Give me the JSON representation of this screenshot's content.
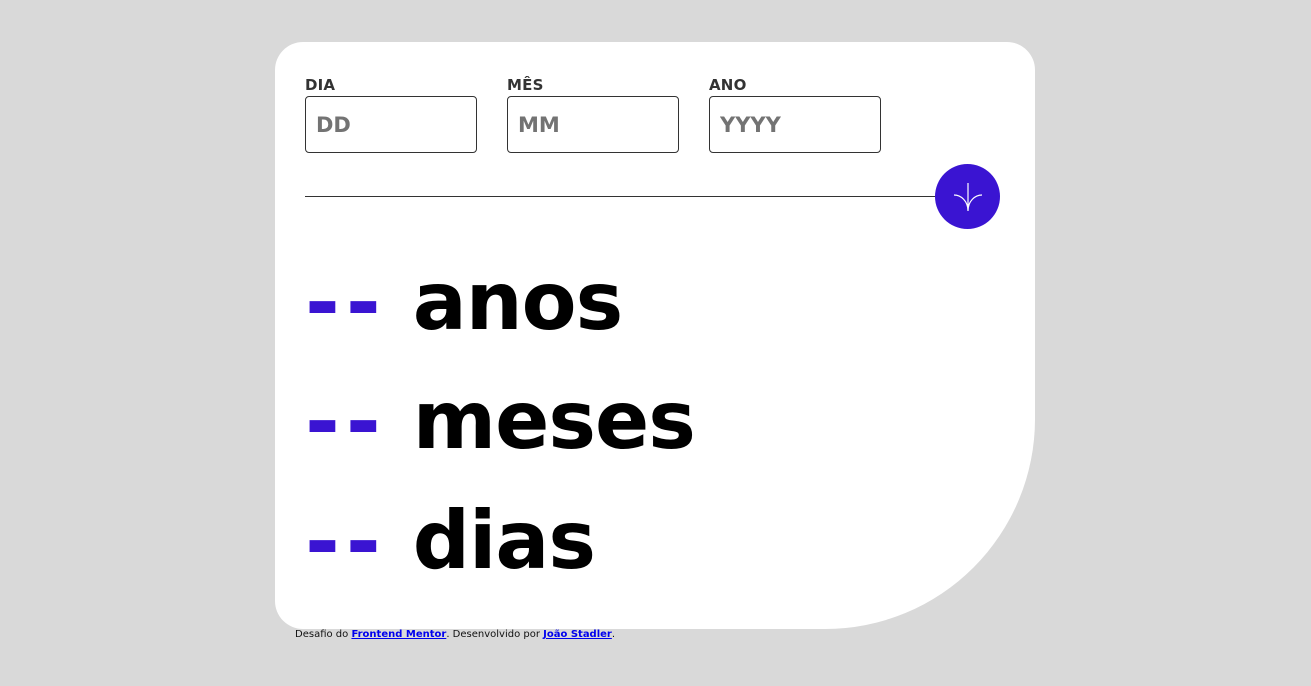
{
  "form": {
    "day": {
      "label": "DIA",
      "placeholder": "DD",
      "value": ""
    },
    "month": {
      "label": "MÊS",
      "placeholder": "MM",
      "value": ""
    },
    "year": {
      "label": "ANO",
      "placeholder": "YYYY",
      "value": ""
    },
    "submit_icon": "arrow-down-icon"
  },
  "results": [
    {
      "value": "--",
      "unit": "anos"
    },
    {
      "value": "--",
      "unit": "meses"
    },
    {
      "value": "--",
      "unit": "dias"
    }
  ],
  "footer": {
    "prefix": "Desafio do ",
    "link1": "Frontend Mentor",
    "middle": ". Desenvolvido por ",
    "link2": "João Stadler",
    "suffix": "."
  },
  "colors": {
    "accent": "#3a14d2",
    "background": "#d9d9d9",
    "card": "#ffffff"
  }
}
